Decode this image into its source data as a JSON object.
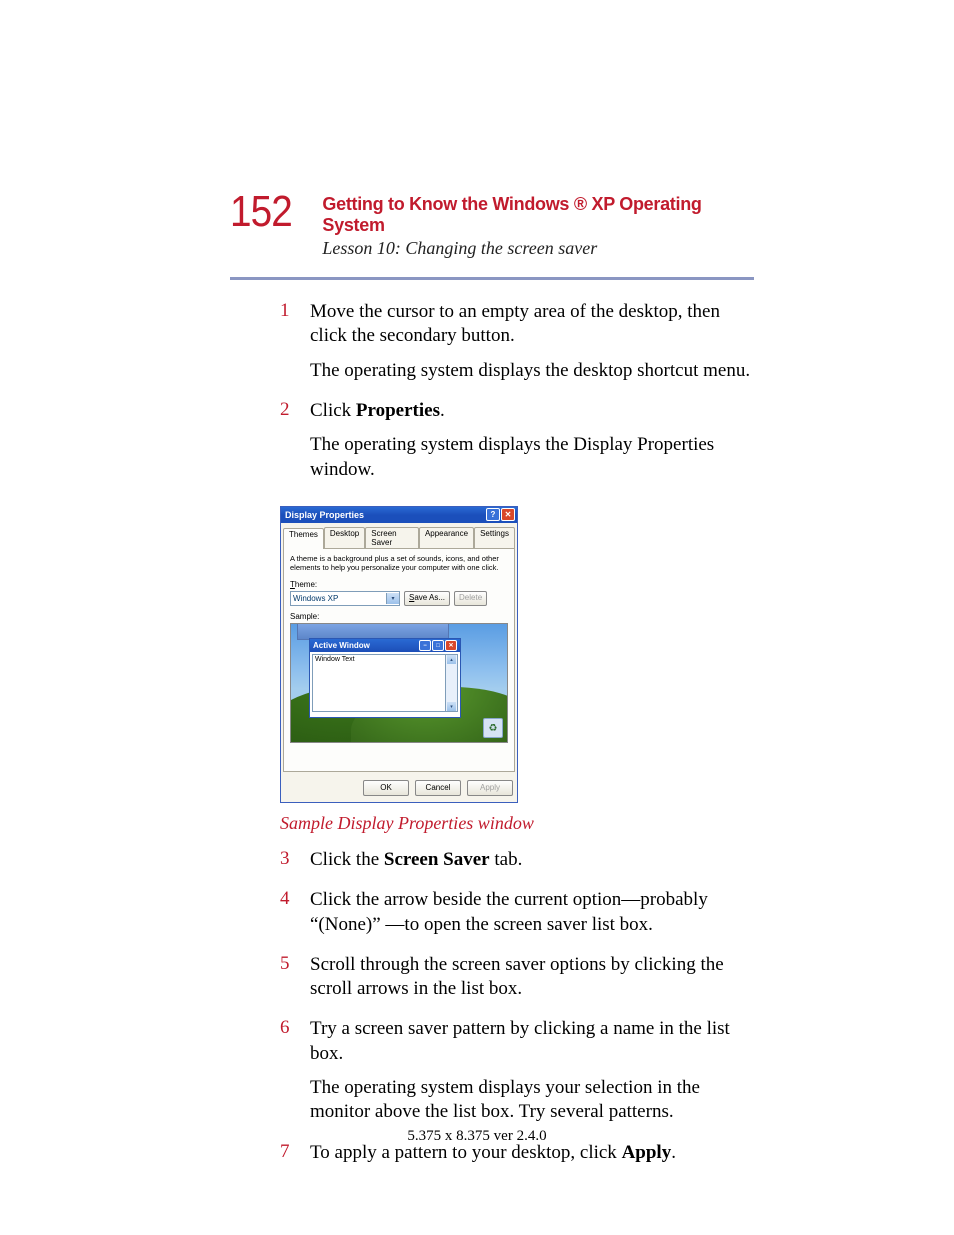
{
  "page_number": "152",
  "chapter_title": "Getting to Know the Windows ® XP Operating System",
  "lesson_title": "Lesson 10: Changing the screen saver",
  "steps": {
    "s1": {
      "num": "1",
      "p1": "Move the cursor to an empty area of the desktop, then click the secondary button.",
      "p2": "The operating system displays the desktop shortcut menu."
    },
    "s2": {
      "num": "2",
      "p1_prefix": "Click ",
      "p1_bold": "Properties",
      "p1_suffix": ".",
      "p2": "The operating system displays the Display Properties window."
    },
    "s3": {
      "num": "3",
      "p1_prefix": "Click the ",
      "p1_bold": "Screen Saver",
      "p1_suffix": " tab."
    },
    "s4": {
      "num": "4",
      "p1": "Click the arrow beside the current option—probably “(None)” —to open the screen saver list box."
    },
    "s5": {
      "num": "5",
      "p1": "Scroll through the screen saver options by clicking the scroll arrows in the list box."
    },
    "s6": {
      "num": "6",
      "p1": "Try a screen saver pattern by clicking a name in the list box.",
      "p2": "The operating system displays your selection in the monitor above the list box. Try several patterns."
    },
    "s7": {
      "num": "7",
      "p1_prefix": "To apply a pattern to your desktop, click ",
      "p1_bold": "Apply",
      "p1_suffix": "."
    }
  },
  "dialog": {
    "title": "Display Properties",
    "help_glyph": "?",
    "close_glyph": "✕",
    "tabs": {
      "themes": "Themes",
      "desktop": "Desktop",
      "screen_saver": "Screen Saver",
      "appearance": "Appearance",
      "settings": "Settings"
    },
    "description": "A theme is a background plus a set of sounds, icons, and other elements to help you personalize your computer with one click.",
    "theme_label": "Theme:",
    "theme_value": "Windows XP",
    "save_as": "Save As...",
    "delete": "Delete",
    "sample_label": "Sample:",
    "active_window": "Active Window",
    "window_text": "Window Text",
    "ok": "OK",
    "cancel": "Cancel",
    "apply": "Apply",
    "recycle_glyph": "♻"
  },
  "caption": "Sample Display Properties window",
  "footer": "5.375 x 8.375 ver 2.4.0"
}
